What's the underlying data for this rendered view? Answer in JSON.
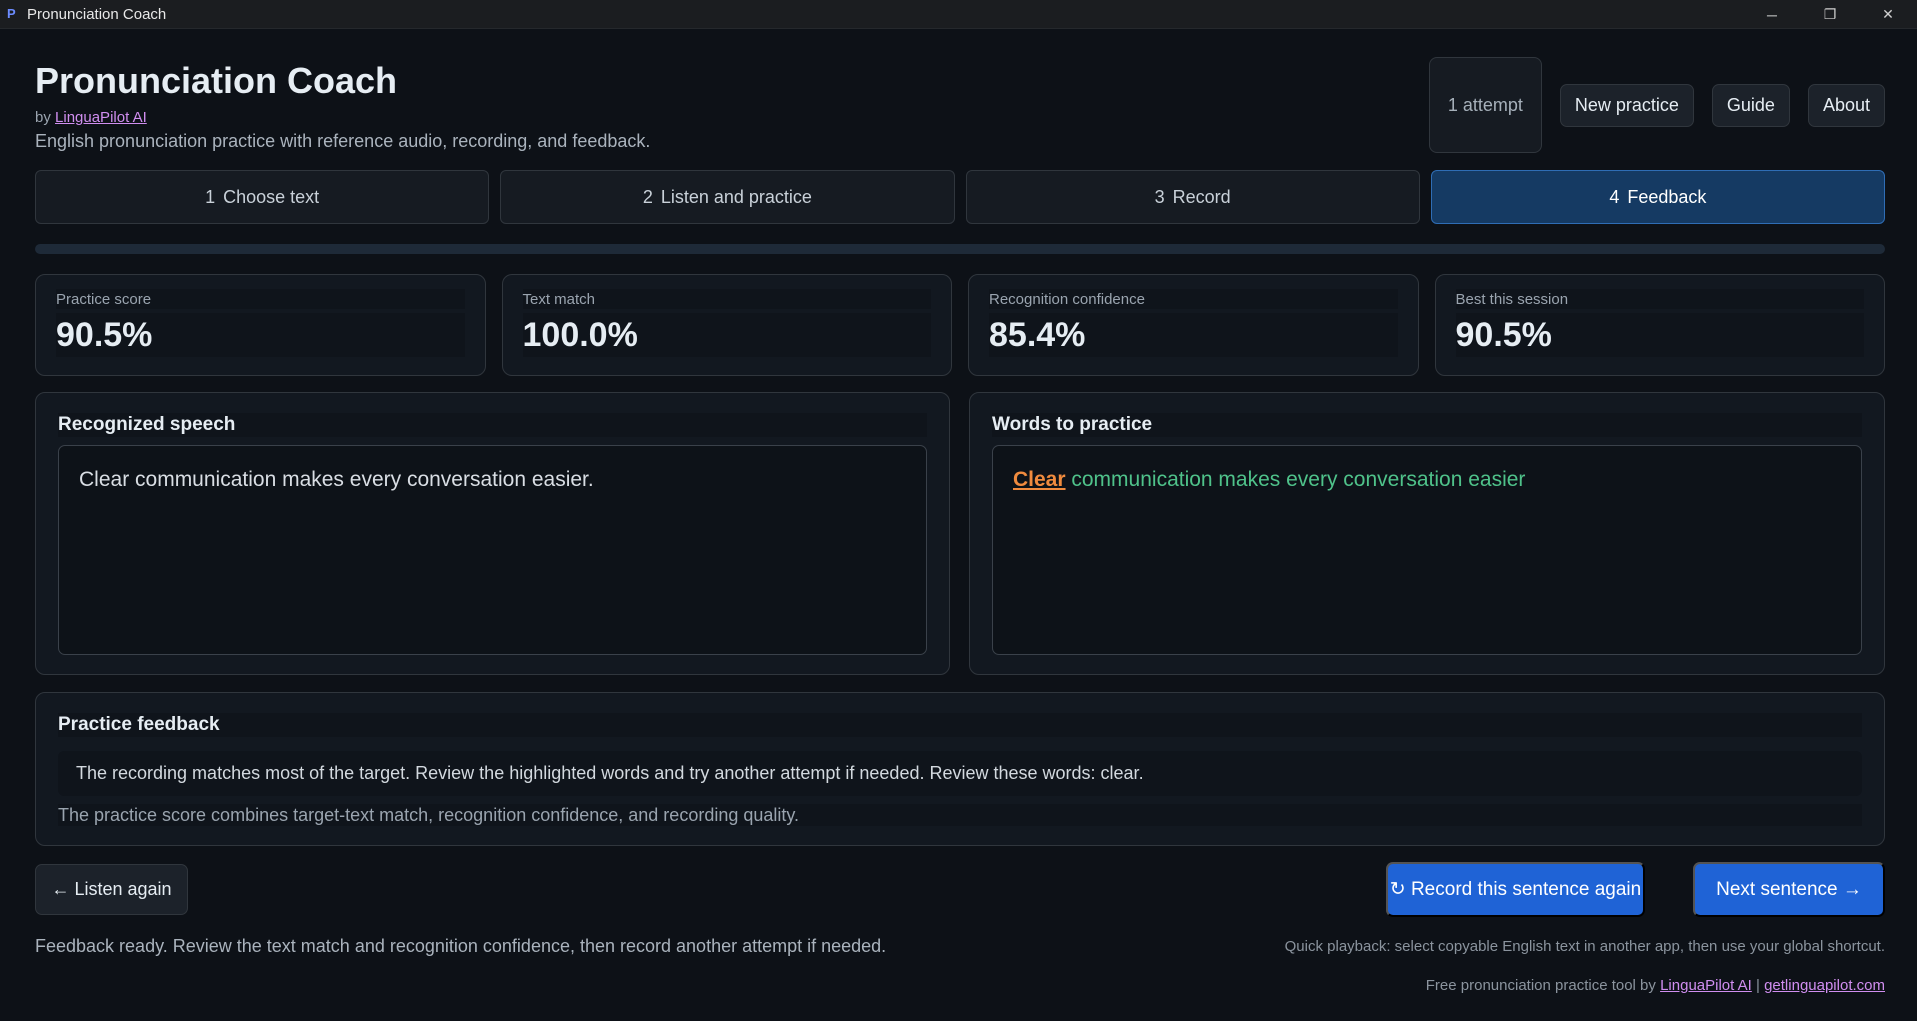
{
  "window": {
    "app_icon": "P",
    "title": "Pronunciation Coach",
    "controls": {
      "minimize": "─",
      "restore": "❐",
      "close": "✕"
    }
  },
  "header": {
    "title": "Pronunciation Coach",
    "by_prefix": "by",
    "by_link": "LinguaPilot AI",
    "subtitle": "English pronunciation practice with reference audio, recording, and feedback.",
    "attempts": "1 attempt",
    "buttons": {
      "new_practice": "New practice",
      "guide": "Guide",
      "about": "About"
    }
  },
  "steps": [
    {
      "num": "1",
      "label": "Choose text",
      "active": false
    },
    {
      "num": "2",
      "label": "Listen and practice",
      "active": false
    },
    {
      "num": "3",
      "label": "Record",
      "active": false
    },
    {
      "num": "4",
      "label": "Feedback",
      "active": true
    }
  ],
  "metrics": [
    {
      "label": "Practice score",
      "value": "90.5%"
    },
    {
      "label": "Text match",
      "value": "100.0%"
    },
    {
      "label": "Recognition confidence",
      "value": "85.4%"
    },
    {
      "label": "Best this session",
      "value": "90.5%"
    }
  ],
  "recognized": {
    "title": "Recognized speech",
    "text": "Clear communication makes every conversation easier."
  },
  "words": {
    "title": "Words to practice",
    "flagged_word": "Clear",
    "rest": "communication makes every conversation easier",
    "colors": {
      "flagged": "#f08b3e",
      "good": "#4fc28a"
    }
  },
  "feedback": {
    "title": "Practice feedback",
    "main": "The recording matches most of the target. Review the highlighted words and try another attempt if needed. Review these words: clear.",
    "note": "The practice score combines target-text match, recognition confidence, and recording quality."
  },
  "actions": {
    "back": "← Listen again",
    "record_again": "↻ Record this sentence again",
    "next": "Next sentence →"
  },
  "status": "Feedback ready. Review the text match and recognition confidence, then record another attempt if needed.",
  "hint": "Quick playback: select copyable English text in another app, then use your global shortcut.",
  "footer": {
    "prefix": "Free pronunciation practice tool by",
    "link1": "LinguaPilot AI",
    "separator": "|",
    "link2": "getlinguapilot.com"
  },
  "theme": {
    "accent": "#1f63d6",
    "active_step": "#153a63",
    "background": "#0d1117"
  }
}
